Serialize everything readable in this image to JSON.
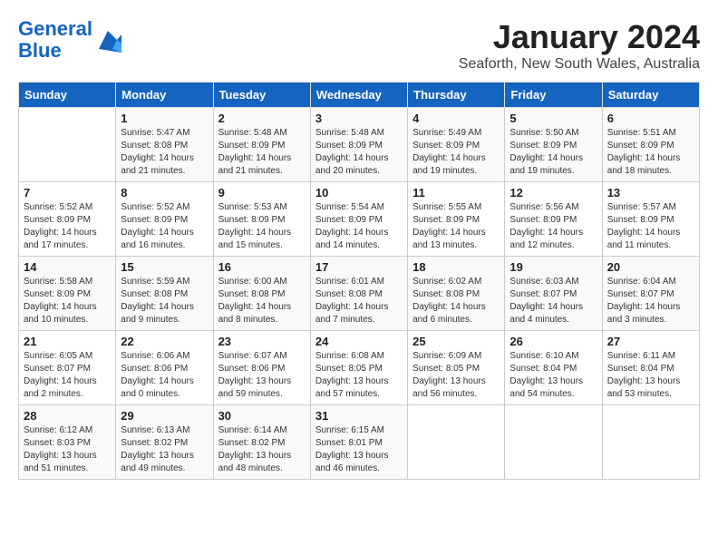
{
  "logo": {
    "line1": "General",
    "line2": "Blue"
  },
  "title": "January 2024",
  "subtitle": "Seaforth, New South Wales, Australia",
  "days_of_week": [
    "Sunday",
    "Monday",
    "Tuesday",
    "Wednesday",
    "Thursday",
    "Friday",
    "Saturday"
  ],
  "weeks": [
    [
      {
        "day": "",
        "info": ""
      },
      {
        "day": "1",
        "info": "Sunrise: 5:47 AM\nSunset: 8:08 PM\nDaylight: 14 hours\nand 21 minutes."
      },
      {
        "day": "2",
        "info": "Sunrise: 5:48 AM\nSunset: 8:09 PM\nDaylight: 14 hours\nand 21 minutes."
      },
      {
        "day": "3",
        "info": "Sunrise: 5:48 AM\nSunset: 8:09 PM\nDaylight: 14 hours\nand 20 minutes."
      },
      {
        "day": "4",
        "info": "Sunrise: 5:49 AM\nSunset: 8:09 PM\nDaylight: 14 hours\nand 19 minutes."
      },
      {
        "day": "5",
        "info": "Sunrise: 5:50 AM\nSunset: 8:09 PM\nDaylight: 14 hours\nand 19 minutes."
      },
      {
        "day": "6",
        "info": "Sunrise: 5:51 AM\nSunset: 8:09 PM\nDaylight: 14 hours\nand 18 minutes."
      }
    ],
    [
      {
        "day": "7",
        "info": "Sunrise: 5:52 AM\nSunset: 8:09 PM\nDaylight: 14 hours\nand 17 minutes."
      },
      {
        "day": "8",
        "info": "Sunrise: 5:52 AM\nSunset: 8:09 PM\nDaylight: 14 hours\nand 16 minutes."
      },
      {
        "day": "9",
        "info": "Sunrise: 5:53 AM\nSunset: 8:09 PM\nDaylight: 14 hours\nand 15 minutes."
      },
      {
        "day": "10",
        "info": "Sunrise: 5:54 AM\nSunset: 8:09 PM\nDaylight: 14 hours\nand 14 minutes."
      },
      {
        "day": "11",
        "info": "Sunrise: 5:55 AM\nSunset: 8:09 PM\nDaylight: 14 hours\nand 13 minutes."
      },
      {
        "day": "12",
        "info": "Sunrise: 5:56 AM\nSunset: 8:09 PM\nDaylight: 14 hours\nand 12 minutes."
      },
      {
        "day": "13",
        "info": "Sunrise: 5:57 AM\nSunset: 8:09 PM\nDaylight: 14 hours\nand 11 minutes."
      }
    ],
    [
      {
        "day": "14",
        "info": "Sunrise: 5:58 AM\nSunset: 8:09 PM\nDaylight: 14 hours\nand 10 minutes."
      },
      {
        "day": "15",
        "info": "Sunrise: 5:59 AM\nSunset: 8:08 PM\nDaylight: 14 hours\nand 9 minutes."
      },
      {
        "day": "16",
        "info": "Sunrise: 6:00 AM\nSunset: 8:08 PM\nDaylight: 14 hours\nand 8 minutes."
      },
      {
        "day": "17",
        "info": "Sunrise: 6:01 AM\nSunset: 8:08 PM\nDaylight: 14 hours\nand 7 minutes."
      },
      {
        "day": "18",
        "info": "Sunrise: 6:02 AM\nSunset: 8:08 PM\nDaylight: 14 hours\nand 6 minutes."
      },
      {
        "day": "19",
        "info": "Sunrise: 6:03 AM\nSunset: 8:07 PM\nDaylight: 14 hours\nand 4 minutes."
      },
      {
        "day": "20",
        "info": "Sunrise: 6:04 AM\nSunset: 8:07 PM\nDaylight: 14 hours\nand 3 minutes."
      }
    ],
    [
      {
        "day": "21",
        "info": "Sunrise: 6:05 AM\nSunset: 8:07 PM\nDaylight: 14 hours\nand 2 minutes."
      },
      {
        "day": "22",
        "info": "Sunrise: 6:06 AM\nSunset: 8:06 PM\nDaylight: 14 hours\nand 0 minutes."
      },
      {
        "day": "23",
        "info": "Sunrise: 6:07 AM\nSunset: 8:06 PM\nDaylight: 13 hours\nand 59 minutes."
      },
      {
        "day": "24",
        "info": "Sunrise: 6:08 AM\nSunset: 8:05 PM\nDaylight: 13 hours\nand 57 minutes."
      },
      {
        "day": "25",
        "info": "Sunrise: 6:09 AM\nSunset: 8:05 PM\nDaylight: 13 hours\nand 56 minutes."
      },
      {
        "day": "26",
        "info": "Sunrise: 6:10 AM\nSunset: 8:04 PM\nDaylight: 13 hours\nand 54 minutes."
      },
      {
        "day": "27",
        "info": "Sunrise: 6:11 AM\nSunset: 8:04 PM\nDaylight: 13 hours\nand 53 minutes."
      }
    ],
    [
      {
        "day": "28",
        "info": "Sunrise: 6:12 AM\nSunset: 8:03 PM\nDaylight: 13 hours\nand 51 minutes."
      },
      {
        "day": "29",
        "info": "Sunrise: 6:13 AM\nSunset: 8:02 PM\nDaylight: 13 hours\nand 49 minutes."
      },
      {
        "day": "30",
        "info": "Sunrise: 6:14 AM\nSunset: 8:02 PM\nDaylight: 13 hours\nand 48 minutes."
      },
      {
        "day": "31",
        "info": "Sunrise: 6:15 AM\nSunset: 8:01 PM\nDaylight: 13 hours\nand 46 minutes."
      },
      {
        "day": "",
        "info": ""
      },
      {
        "day": "",
        "info": ""
      },
      {
        "day": "",
        "info": ""
      }
    ]
  ]
}
